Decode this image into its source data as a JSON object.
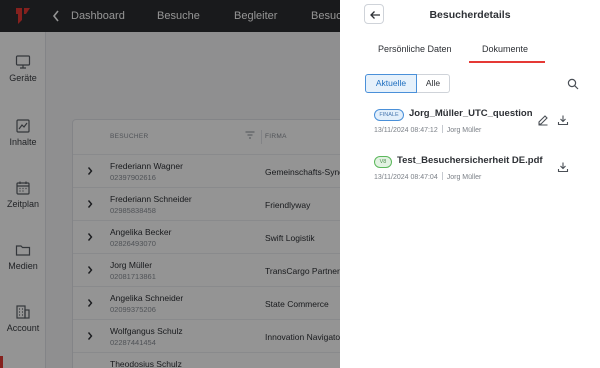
{
  "topnav": {
    "items": [
      "Dashboard",
      "Besuche",
      "Begleiter",
      "Besuch"
    ]
  },
  "sidebar": {
    "items": [
      {
        "label": "Geräte",
        "icon": "monitor-icon"
      },
      {
        "label": "Inhalte",
        "icon": "content-icon"
      },
      {
        "label": "Zeitplan",
        "icon": "calendar-icon"
      },
      {
        "label": "Medien",
        "icon": "folder-icon"
      },
      {
        "label": "Account",
        "icon": "building-icon"
      }
    ]
  },
  "table": {
    "columns": [
      "BESUCHER",
      "FIRMA"
    ],
    "rows": [
      {
        "name": "Frederiann Wagner",
        "phone": "02397902616",
        "company": "Gemeinschafts-Syne"
      },
      {
        "name": "Frederiann Schneider",
        "phone": "02985838458",
        "company": "Friendlyway"
      },
      {
        "name": "Angelika Becker",
        "phone": "02826493070",
        "company": "Swift Logistik"
      },
      {
        "name": "Jorg Müller",
        "phone": "02081713861",
        "company": "TransCargo Partner"
      },
      {
        "name": "Angelika Schneider",
        "phone": "02099375206",
        "company": "State Commerce"
      },
      {
        "name": "Wolfgangus Schulz",
        "phone": "02287441454",
        "company": "Innovation Navigato"
      },
      {
        "name": "Theodosius Schulz",
        "phone": "",
        "company": ""
      }
    ]
  },
  "panel": {
    "title": "Besucherdetails",
    "tabs": [
      "Persönliche Daten",
      "Dokumente"
    ],
    "active_tab": "Dokumente",
    "filter": {
      "active": "Aktuelle",
      "inactive": "Alle"
    },
    "documents": [
      {
        "badge": "FINALE",
        "title": "Jorg_Müller_UTC_question...",
        "date": "13/11/2024 08:47:12",
        "author": "Jorg Müller",
        "editable": true
      },
      {
        "badge": "V8",
        "title": "Test_Besuchersicherheit DE.pdf",
        "date": "13/11/2024 08:47:04",
        "author": "Jorg Müller",
        "editable": false
      }
    ]
  },
  "colors": {
    "accent": "#e53935",
    "active_blue": "#4a90d9",
    "topbar": "#2b2d31"
  }
}
